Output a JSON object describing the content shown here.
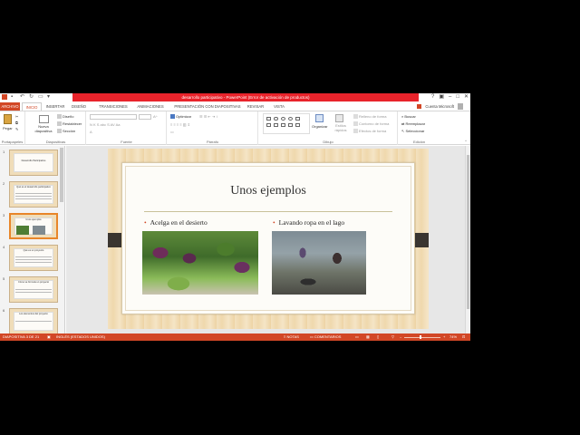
{
  "window": {
    "title": "desarrollo participativo  -  PowerPoint (Error de activación de productos)"
  },
  "tabs": [
    {
      "label": "ARCHIVO"
    },
    {
      "label": "INICIO"
    },
    {
      "label": "INSERTAR"
    },
    {
      "label": "DISEÑO"
    },
    {
      "label": "TRANSICIONES"
    },
    {
      "label": "ANIMACIONES"
    },
    {
      "label": "PRESENTACIÓN CON DIAPOSITIVAS"
    },
    {
      "label": "REVISAR"
    },
    {
      "label": "VISTA"
    }
  ],
  "account": {
    "name": "Cuenta Microsoft"
  },
  "ribbon": {
    "clipboard": {
      "paste": "Pegar",
      "group": "Portapapeles"
    },
    "slides": {
      "new_slide": "Nueva diapositiva",
      "layout": "Diseño",
      "reset": "Restablecer",
      "section": "Sección",
      "group": "Diapositivas"
    },
    "font": {
      "group": "Fuente"
    },
    "paragraph": {
      "optimize": "Optimizar",
      "group": "Párrafo"
    },
    "drawing": {
      "arrange": "Organizar",
      "quick_styles": "Estilos rápidos",
      "fill": "Relleno de forma",
      "outline": "Contorno de forma",
      "effects": "Efectos de forma",
      "group": "Dibujo"
    },
    "editing": {
      "find": "Buscar",
      "replace": "Reemplazar",
      "select": "Seleccionar",
      "group": "Edición"
    }
  },
  "thumbnails": [
    {
      "num": "1",
      "title": "Desarrollo Participativo"
    },
    {
      "num": "2",
      "title": "Qué es el desarrollo participativo"
    },
    {
      "num": "3",
      "title": "Unos ejemplos"
    },
    {
      "num": "4",
      "title": "Qué es un proyecto"
    },
    {
      "num": "5",
      "title": "Cómo se formula un proyecto"
    },
    {
      "num": "6",
      "title": "Los elementos del proyecto"
    }
  ],
  "slide": {
    "title": "Unos ejemplos",
    "bullets": [
      "Acelga en el desierto",
      "Lavando ropa en el lago"
    ]
  },
  "status": {
    "slide_count": "DIAPOSITIVA 3 DE 21",
    "language": "INGLÉS (ESTADOS UNIDOS)",
    "notes": "NOTAS",
    "comments": "COMENTARIOS",
    "zoom": "74%"
  },
  "colors": {
    "accent": "#d24726",
    "title_band": "#e8232b"
  }
}
